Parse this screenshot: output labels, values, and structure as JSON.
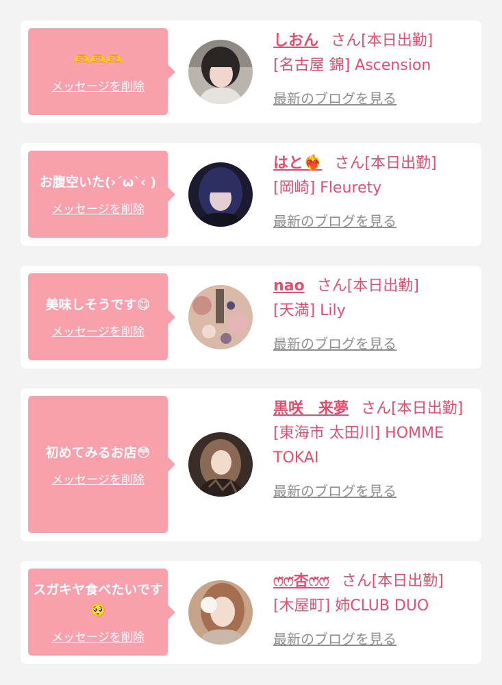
{
  "colors": {
    "background": "#f3f3f3",
    "bubble": "#f9a0ad",
    "accent": "#e0506e",
    "blog_link": "#8e8e8e"
  },
  "common": {
    "delete_label": "メッセージを削除",
    "blog_label": "最新のブログを見る"
  },
  "cards": [
    {
      "message": "🫶🫶🫶",
      "name": "しおん",
      "suffix": "さん[本日出勤]",
      "shop": "[名古屋 錦] Ascension"
    },
    {
      "message": "お腹空いた(›´ω`‹ )",
      "name": "はと❤️‍🔥",
      "suffix": "さん[本日出勤]",
      "shop": "[岡崎] Fleurety"
    },
    {
      "message": "美味しそうです😋",
      "name": "nao",
      "suffix": "さん[本日出勤]",
      "shop": "[天満] Lily"
    },
    {
      "message": "初めてみるお店😳",
      "name": "黒咲　来夢",
      "suffix": "さん[本日出勤]",
      "shop": "[東海市 太田川] HOMME TOKAI"
    },
    {
      "message": "スガキヤ食べたいです🥺",
      "name": "ෆ̈ෆ̈杏ෆ̈ෆ̈",
      "suffix": "さん[本日出勤]",
      "shop": "[木屋町] 姉CLUB DUO"
    }
  ]
}
